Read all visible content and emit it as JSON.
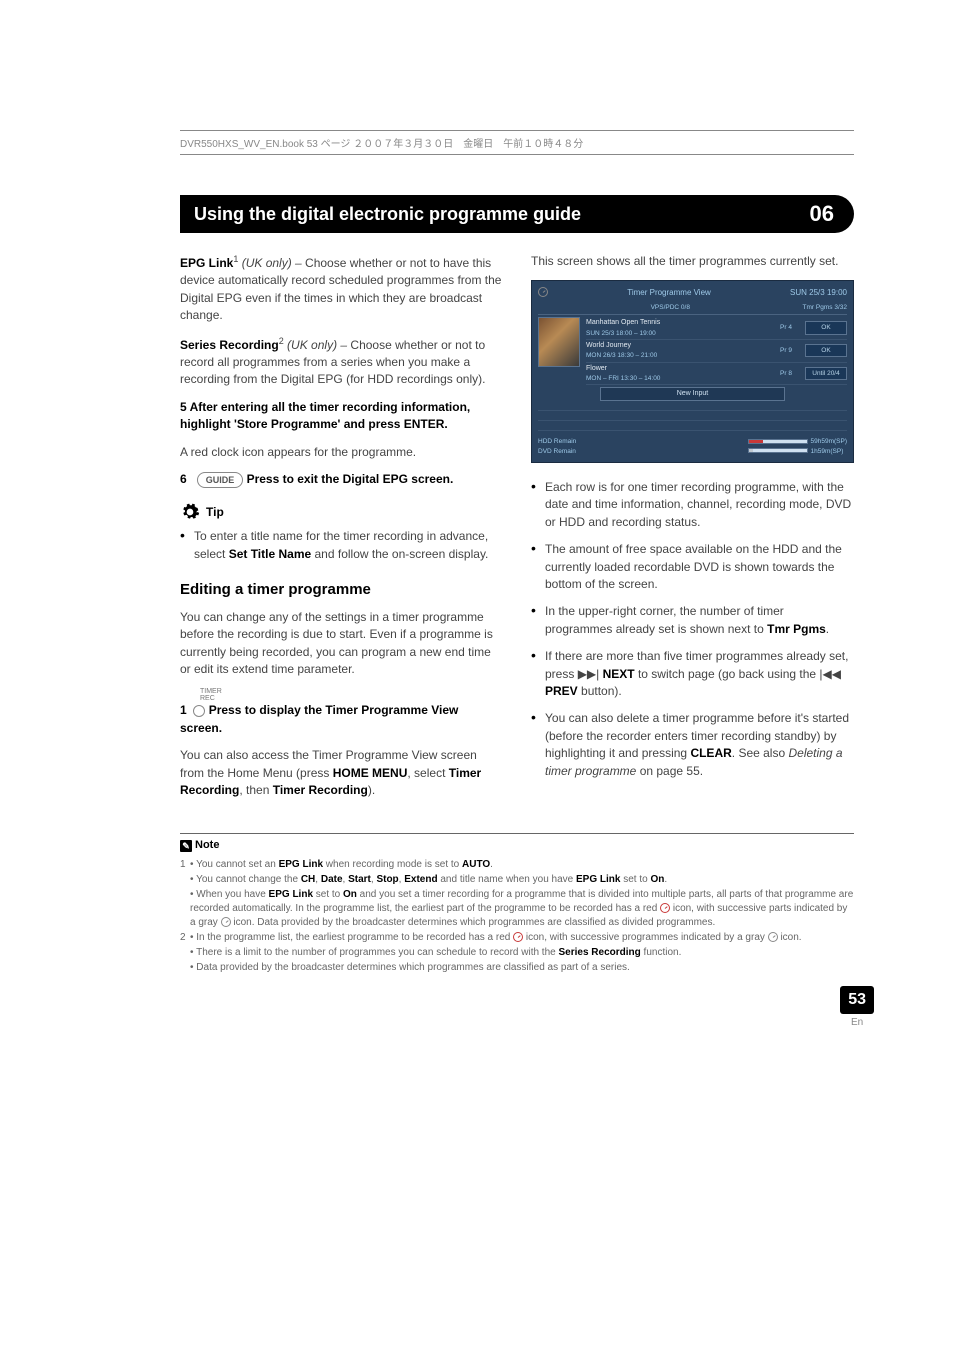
{
  "book_header": "DVR550HXS_WV_EN.book  53 ページ  ２００７年３月３０日　金曜日　午前１０時４８分",
  "chapter": {
    "title": "Using the digital electronic programme guide",
    "number": "06"
  },
  "left_col": {
    "epg_link_label": "EPG Link",
    "epg_link_sup": "1",
    "epg_link_note": " (UK only) – ",
    "epg_link_text": "Choose whether or not to have this device automatically record scheduled programmes from the Digital EPG even if the times in which they are broadcast change.",
    "series_rec_label": "Series Recording",
    "series_rec_sup": "2",
    "series_rec_note": " (UK only) – ",
    "series_rec_text": "Choose whether or not to record all programmes from a series when you make a recording from the Digital EPG (for HDD recordings only).",
    "step5_head": "5    After entering all the timer recording information, highlight 'Store Programme' and press ENTER.",
    "step5_text": "A red clock icon appears for the programme.",
    "step6_num": "6",
    "step6_key": "GUIDE",
    "step6_head": "  Press to exit the Digital EPG screen.",
    "tip_label": " Tip",
    "tip_text_a": "To enter a title name for the timer recording in advance, select ",
    "tip_bold": "Set Title Name",
    "tip_text_b": " and follow the on-screen display.",
    "h2": "Editing a timer programme",
    "edit_text": "You can change any of the settings in a timer programme before the recording is due to start. Even if a programme is currently being recorded, you can program a new end time or edit its extend time parameter.",
    "step1_num": "1",
    "step1_remote_top": "TIMER",
    "step1_remote_bottom": "REC",
    "step1_head": " Press to display the Timer Programme View screen.",
    "step1_text_a": "You can also access the Timer Programme View screen from the Home Menu (press ",
    "step1_b1": "HOME MENU",
    "step1_text_b": ", select ",
    "step1_b2": "Timer Recording",
    "step1_text_c": ", then ",
    "step1_b3": "Timer Recording",
    "step1_text_d": ")."
  },
  "right_col": {
    "intro": "This screen shows all the timer programmes currently set.",
    "bullets": {
      "b1": "Each row is for one timer recording programme, with the date and time information, channel, recording mode, DVD or HDD and recording status.",
      "b2": "The amount of free space available on the HDD and the currently loaded recordable DVD is shown towards the bottom of the screen.",
      "b3a": "In the upper-right corner, the number of timer programmes already set is shown next to ",
      "b3b": "Tmr Pgms",
      "b3c": ".",
      "b4a": "If there are more than five timer programmes already set, press ",
      "b4next": " NEXT",
      "b4b": " to switch page (go back using the ",
      "b4prev": " PREV",
      "b4c": " button).",
      "b5a": "You can also delete a timer programme before it's started (before the recorder enters timer recording standby) by highlighting it and pressing ",
      "b5clear": "CLEAR",
      "b5b": ". See also ",
      "b5i": "Deleting a timer programme",
      "b5c": " on page 55."
    }
  },
  "scr": {
    "title": "Timer Programme View",
    "datetime": "SUN 25/3  19:00",
    "vps": "VPS/PDC 0/8",
    "tmr": "Tmr Pgms  3/32",
    "rows": [
      {
        "name": "Manhattan Open Tennis",
        "time": "SUN 25/3    18:00 – 19:00",
        "pr": "Pr 4",
        "status": "OK"
      },
      {
        "name": "World Journey",
        "time": "MON 26/3    18:30 – 21:00",
        "pr": "Pr 9",
        "status": "OK"
      },
      {
        "name": "Flower",
        "time": "MON – FRI  13:30 – 14:00",
        "pr": "Pr 8",
        "status": "Until 20/4"
      }
    ],
    "newinput": "New Input",
    "hdd_label": "HDD Remain",
    "dvd_label": "DVD Remain",
    "hdd_val": "59h59m(SP)",
    "dvd_val": "1h59m(SP)"
  },
  "notes": {
    "label": "Note",
    "n1a": "• You cannot set an ",
    "n1b": "EPG Link",
    "n1c": " when recording mode is set to ",
    "n1d": "AUTO",
    "n1e": ".",
    "n2a": "• You cannot change the ",
    "n2ch": "CH",
    "n2sep1": ", ",
    "n2date": "Date",
    "n2sep2": ", ",
    "n2start": "Start",
    "n2sep3": ", ",
    "n2stop": "Stop",
    "n2sep4": ", ",
    "n2ext": "Extend",
    "n2b": " and title name when you have ",
    "n2epg": "EPG Link",
    "n2c": " set to ",
    "n2on": "On",
    "n2d": ".",
    "n3a": "• When you have ",
    "n3epg": "EPG Link",
    "n3b": " set to ",
    "n3on": "On",
    "n3c": " and you set a timer recording for a programme that is divided into multiple parts, all parts of that programme are recorded automatically. In the programme list, the earliest part of the programme to be recorded has a red ",
    "n3d": " icon, with successive parts indicated by a gray ",
    "n3e": " icon. Data provided by the broadcaster determines which programmes are classified as divided programmes.",
    "n4a": "• In the programme list, the earliest programme to be recorded has a red ",
    "n4b": " icon, with successive programmes indicated by a gray ",
    "n4c": " icon.",
    "n5a": "• There is a limit to the number of programmes you can schedule to record with the ",
    "n5b": "Series Recording",
    "n5c": " function.",
    "n6": "• Data provided by the broadcaster determines which programmes are classified as part of a series."
  },
  "page_number": "53",
  "page_lang": "En"
}
